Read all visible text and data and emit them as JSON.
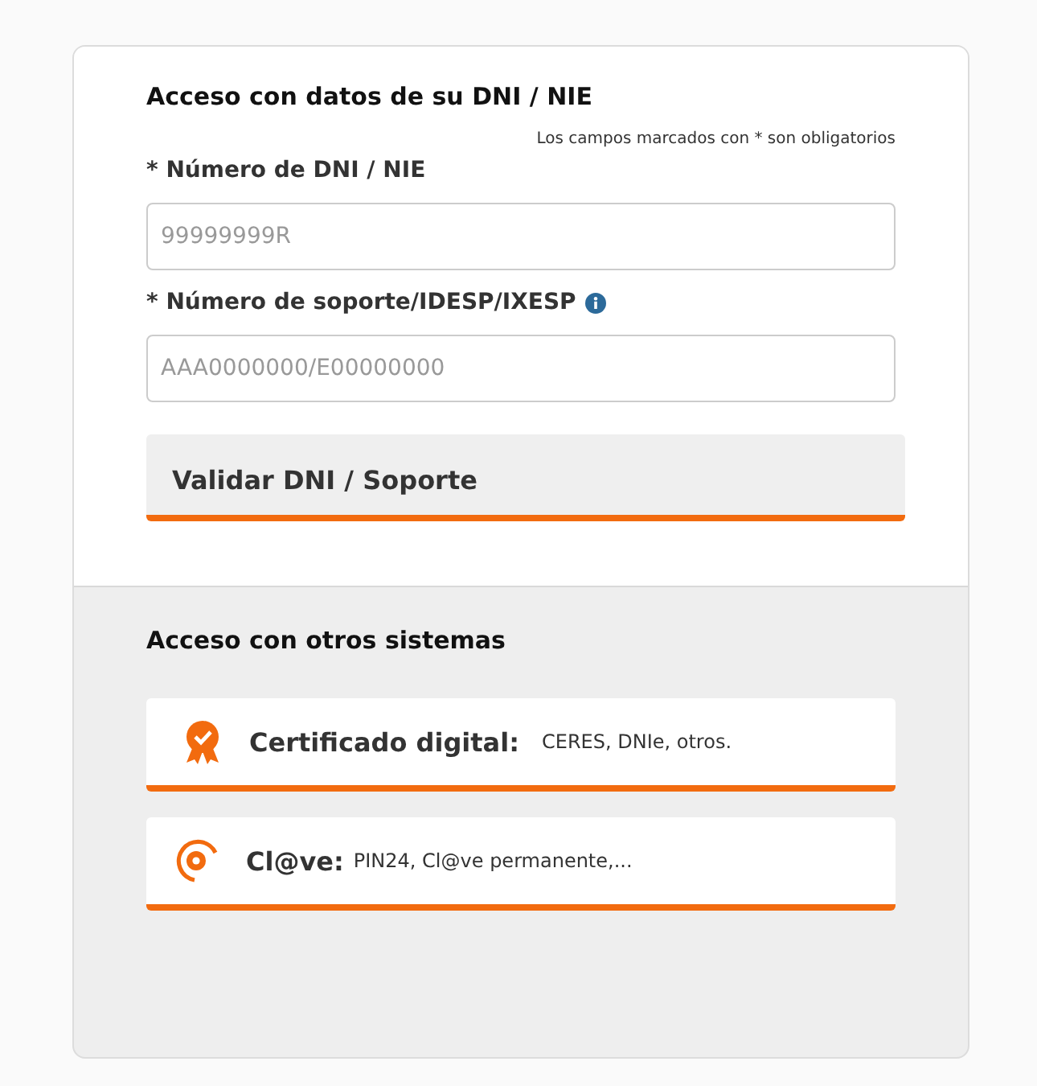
{
  "dni_section": {
    "title": "Acceso con datos de su DNI / NIE",
    "required_note": "Los campos marcados con * son obligatorios",
    "fields": [
      {
        "label": "* Número de DNI / NIE",
        "placeholder": "99999999R",
        "info": false
      },
      {
        "label": "* Número de soporte/IDESP/IXESP",
        "placeholder": "AAA0000000/E00000000",
        "info": true
      }
    ],
    "validate_button": "Validar DNI / Soporte"
  },
  "other_section": {
    "title": "Acceso con otros sistemas",
    "options": [
      {
        "kind": "certificate",
        "name": "Certificado digital:",
        "detail": "CERES, DNIe, otros."
      },
      {
        "kind": "clave",
        "name": "Cl@ve:",
        "detail": "PIN24, Cl@ve permanente,..."
      }
    ]
  }
}
